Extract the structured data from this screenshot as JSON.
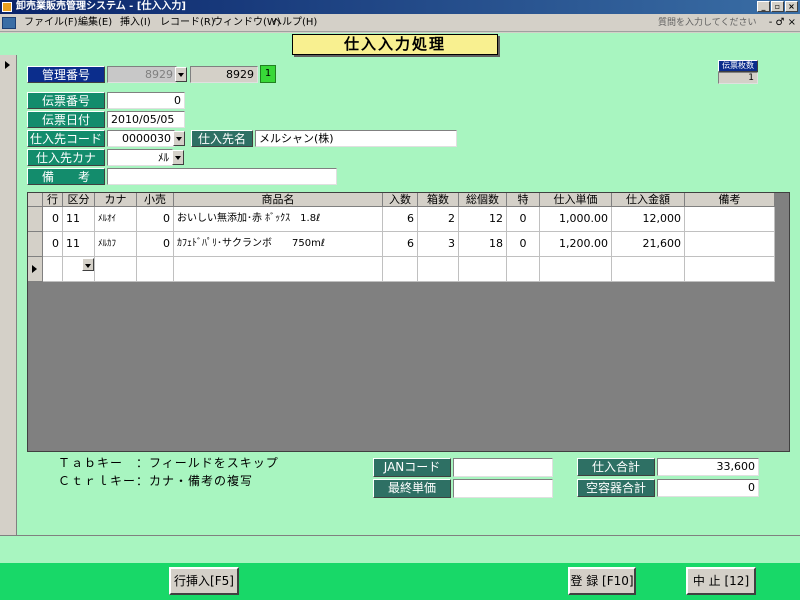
{
  "window": {
    "title": "卸売業販売管理システム - [仕入入力]"
  },
  "menu": {
    "items": [
      "ファイル(F)",
      "編集(E)",
      "挿入(I)",
      "レコード(R)",
      "ウィンドウ(W)",
      "ヘルプ(H)"
    ],
    "help_placeholder": "質問を入力してください",
    "window_controls": "- ♂ ×"
  },
  "form": {
    "title": "仕入入力処理",
    "slip_count_label": "伝票枚数",
    "slip_count_value": "1",
    "kanri_label": "管理番号",
    "kanri_value_disabled": "8929",
    "kanri_value": "8929",
    "kanri_badge": "1",
    "denpyo_label": "伝票番号",
    "denpyo_value": "0",
    "date_label": "伝票日付",
    "date_value": "2010/05/05",
    "supplier_code_label": "仕入先コード",
    "supplier_code_value": "0000030",
    "supplier_name_label": "仕入先名",
    "supplier_name_value": "メルシャン(株)",
    "supplier_kana_label": "仕入先カナ",
    "supplier_kana_value": "ﾒﾙ",
    "remarks_label": "備　　考",
    "remarks_value": ""
  },
  "grid": {
    "headers": [
      "行",
      "区分",
      "カナ",
      "小売",
      "商品名",
      "入数",
      "箱数",
      "総個数",
      "特",
      "仕入単価",
      "仕入金額",
      "備考"
    ],
    "rows": [
      {
        "line": "0",
        "kubun": "11",
        "kana": "ﾒﾙｵｲ",
        "kouri": "0",
        "name": "おいしい無添加･赤 ﾎﾞｯｸｽ　1.8ℓ",
        "irisu": "6",
        "hakosu": "2",
        "total": "12",
        "toku": "0",
        "price": "1,000.00",
        "amount": "12,000",
        "note": ""
      },
      {
        "line": "0",
        "kubun": "11",
        "kana": "ﾒﾙｶﾌ",
        "kouri": "0",
        "name": "ｶﾌｪﾄﾞﾊﾟﾘ･サクランボ　　750mℓ",
        "irisu": "6",
        "hakosu": "3",
        "total": "18",
        "toku": "0",
        "price": "1,200.00",
        "amount": "21,600",
        "note": ""
      }
    ]
  },
  "hints": {
    "line1": "Ｔａｂキー　：フィールドをスキップ",
    "line2": "Ｃｔｒｌキー：カナ・備考の複写"
  },
  "totals": {
    "jan_label": "JANコード",
    "jan_value": "",
    "last_price_label": "最終単価",
    "last_price_value": "",
    "purchase_total_label": "仕入合計",
    "purchase_total_value": "33,600",
    "container_total_label": "空容器合計",
    "container_total_value": "0"
  },
  "buttons": {
    "insert_row": "行挿入[F5]",
    "register": "登 録 [F10]",
    "cancel": "中 止 [12]"
  }
}
